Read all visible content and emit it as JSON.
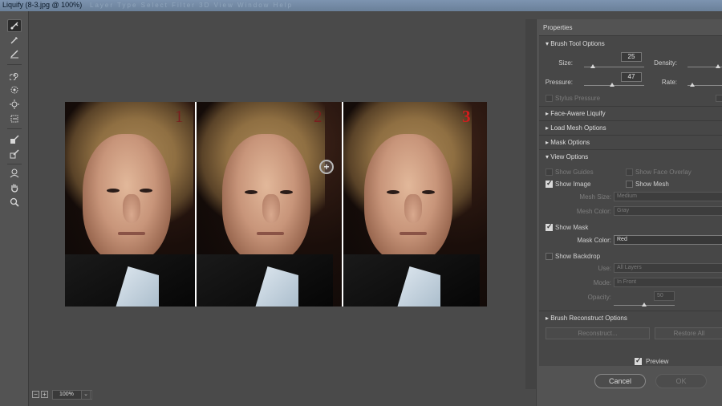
{
  "window": {
    "title": "Liquify (8-3.jpg @ 100%)",
    "ghost_menu": "Layer   Type   Select   Filter   3D   View   Window   Help"
  },
  "toolbar": {
    "tools": [
      "forward-warp",
      "reconstruct",
      "smooth",
      "twirl",
      "pucker",
      "bloat",
      "push-left",
      "freeze-mask",
      "thaw-mask",
      "face",
      "hand",
      "zoom"
    ]
  },
  "canvas": {
    "labels": [
      "1",
      "2",
      "3"
    ],
    "label_colors": [
      "#7a1f1f",
      "#7a1f1f",
      "#d11d1d"
    ],
    "zoom": "100%"
  },
  "properties": {
    "title": "Properties",
    "brush_tool_options": {
      "header": "Brush Tool Options",
      "size_label": "Size:",
      "size_value": "25",
      "density_label": "Density:",
      "pressure_label": "Pressure:",
      "pressure_value": "47",
      "rate_label": "Rate:",
      "stylus_pressure": "Stylus Pressure"
    },
    "face_aware": "Face-Aware Liquify",
    "load_mesh": "Load Mesh Options",
    "mask_options": "Mask Options",
    "view_options": {
      "header": "View Options",
      "show_guides": "Show Guides",
      "show_face_overlay": "Show Face Overlay",
      "show_image": "Show Image",
      "show_mesh": "Show Mesh",
      "mesh_size_label": "Mesh Size:",
      "mesh_size_value": "Medium",
      "mesh_color_label": "Mesh Color:",
      "mesh_color_value": "Gray",
      "show_mask": "Show Mask",
      "mask_color_label": "Mask Color:",
      "mask_color_value": "Red",
      "show_backdrop": "Show Backdrop",
      "use_label": "Use:",
      "use_value": "All Layers",
      "mode_label": "Mode:",
      "mode_value": "In Front",
      "opacity_label": "Opacity:",
      "opacity_value": "50"
    },
    "brush_reconstruct": {
      "header": "Brush Reconstruct Options",
      "reconstruct": "Reconstruct...",
      "restore_all": "Restore All"
    },
    "preview": "Preview",
    "cancel": "Cancel",
    "ok": "OK"
  }
}
